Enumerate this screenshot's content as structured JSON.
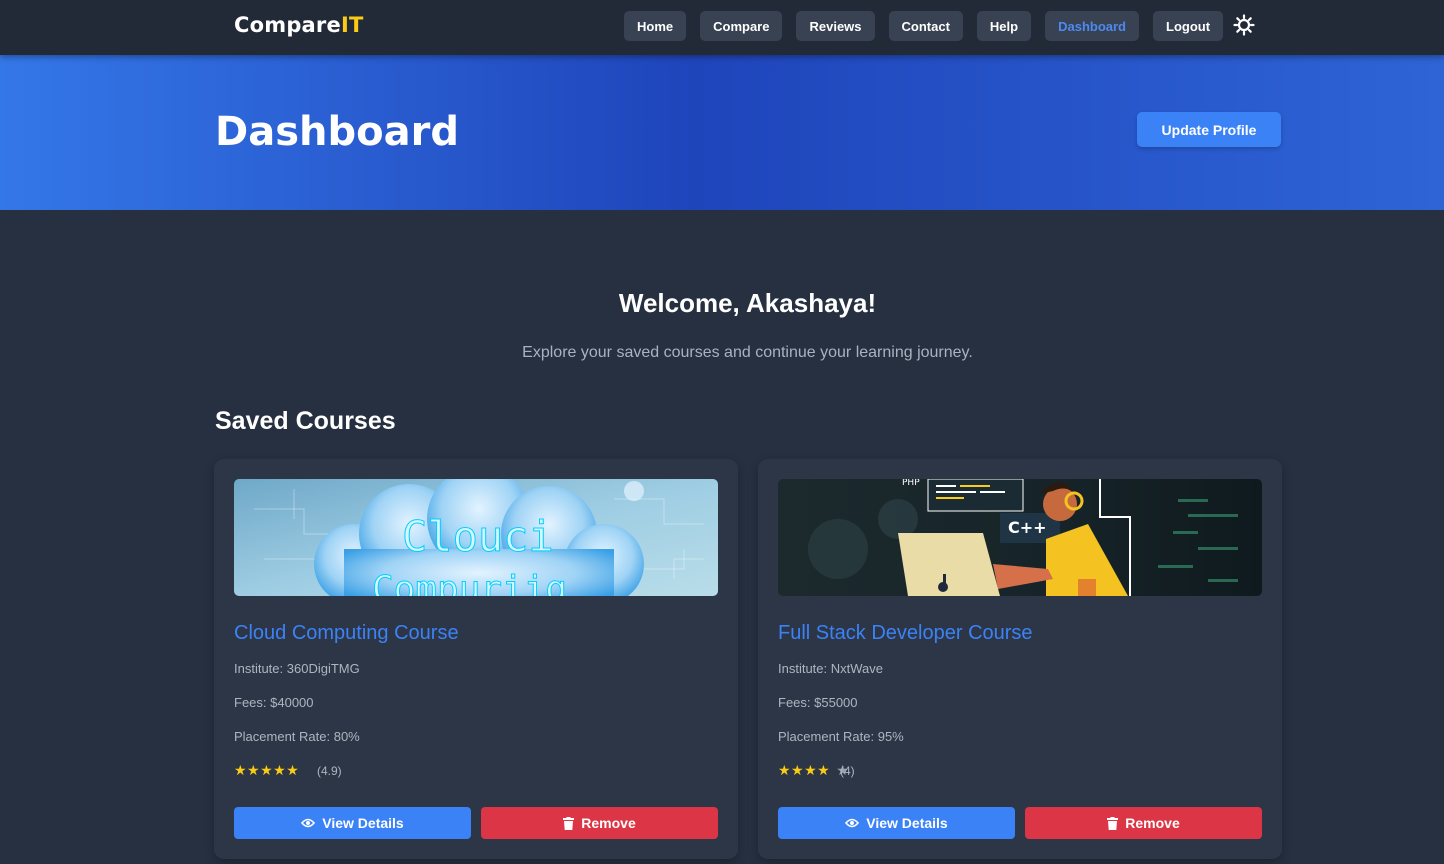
{
  "nav": {
    "logo_main": "Compare",
    "logo_accent": "IT",
    "links": [
      "Home",
      "Compare",
      "Reviews",
      "Contact",
      "Help",
      "Dashboard",
      "Logout"
    ],
    "active": "Dashboard",
    "theme_icon": "sun-icon"
  },
  "hero": {
    "title": "Dashboard",
    "update_label": "Update Profile"
  },
  "main": {
    "welcome": "Welcome, Akashaya!",
    "subtitle": "Explore your saved courses and continue your learning journey.",
    "section_title": "Saved Courses"
  },
  "courses": [
    {
      "title": "Cloud Computing Course",
      "image_text_1": "Clouci",
      "image_text_2": "Compuriig",
      "institute": "Institute: 360DigiTMG",
      "fees": "Fees: $40000",
      "placement": "Placement Rate: 80%",
      "stars_filled": "★★★★★",
      "stars_empty": "",
      "rating": 4.9,
      "rating_text": "(4.9)",
      "view_label": "View Details",
      "remove_label": "Remove"
    },
    {
      "title": "Full Stack Developer Course",
      "image_text_1": "PHP",
      "image_text_2": "C++",
      "institute": "Institute: NxtWave",
      "fees": "Fees: $55000",
      "placement": "Placement Rate: 95%",
      "stars_filled": "★★★★",
      "stars_empty": "★",
      "rating": 4,
      "rating_text": "(4)",
      "view_label": "View Details",
      "remove_label": "Remove"
    }
  ],
  "colors": {
    "background": "#263041",
    "navbar": "#222a37",
    "card": "#2d3646",
    "accent_blue": "#3b82f6",
    "danger_red": "#dc3545",
    "star_yellow": "#facc15",
    "logo_accent": "#facc15"
  }
}
